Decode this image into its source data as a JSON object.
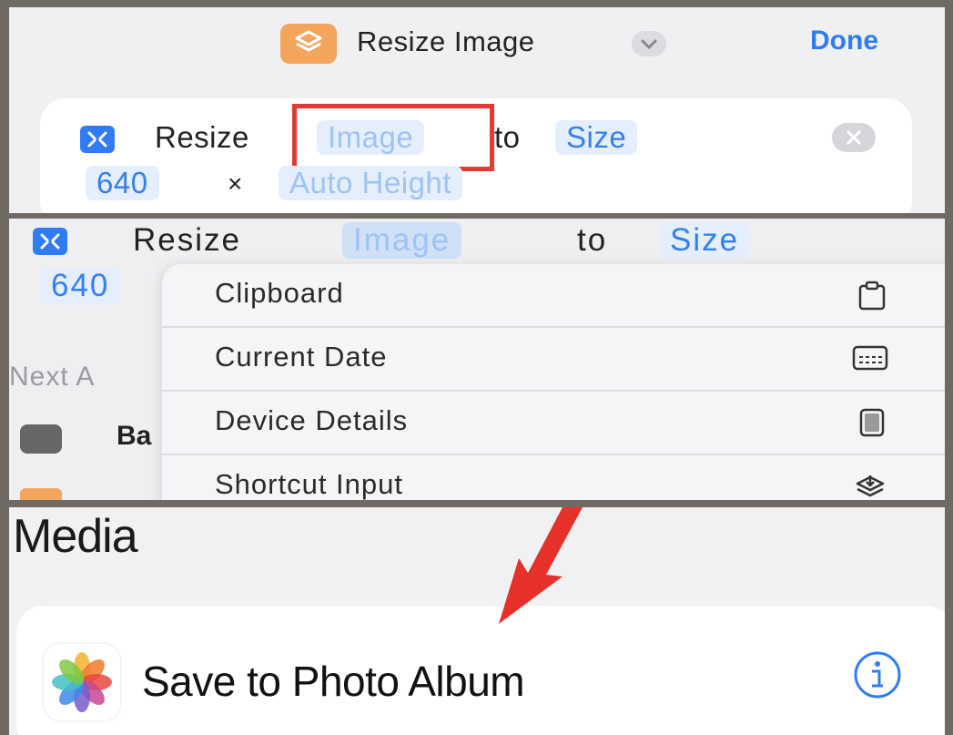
{
  "panel1": {
    "title": "Resize Image",
    "done_label": "Done",
    "action": {
      "verb": "Resize",
      "image_token": "Image",
      "to": "to",
      "size_token": "Size",
      "width": "640",
      "times": "×",
      "height_token": "Auto Height"
    }
  },
  "panel2": {
    "action": {
      "verb": "Resize",
      "image_token": "Image",
      "to": "to",
      "size_token": "Size",
      "width_partial": "640"
    },
    "background": {
      "next_partial": "Next A",
      "row_partial": "Ba"
    },
    "menu_items": [
      {
        "label": "Clipboard",
        "icon": "clipboard-icon"
      },
      {
        "label": "Current Date",
        "icon": "calendar-icon"
      },
      {
        "label": "Device Details",
        "icon": "device-icon"
      },
      {
        "label": "Shortcut Input",
        "icon": "shortcut-input-icon"
      }
    ]
  },
  "panel3": {
    "section_title": "Media",
    "item_label": "Save to Photo Album",
    "accent_color": "#2f7cf6",
    "highlight_color": "#e53935"
  }
}
